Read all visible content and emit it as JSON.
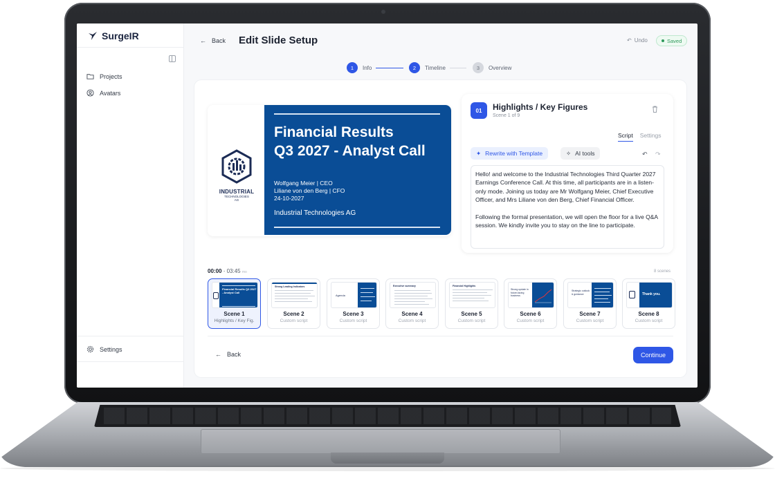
{
  "app": {
    "name": "SurgeIR"
  },
  "sidebar": {
    "items": [
      {
        "label": "Projects",
        "icon": "folder-icon"
      },
      {
        "label": "Avatars",
        "icon": "user-circle-icon"
      }
    ],
    "settings_label": "Settings"
  },
  "header": {
    "back_label": "Back",
    "title": "Edit Slide Setup",
    "undo_label": "Undo",
    "saved_label": "Saved"
  },
  "stepper": [
    {
      "number": "1",
      "label": "Info",
      "state": "done"
    },
    {
      "number": "2",
      "label": "Timeline",
      "state": "active"
    },
    {
      "number": "3",
      "label": "Overview",
      "state": "upcoming"
    }
  ],
  "slide": {
    "logo_line1": "INDUSTRIAL",
    "logo_line2": "TECHNOLOGIES",
    "logo_line3": "AG",
    "title_line1": "Financial Results",
    "title_line2": "Q3 2027 - Analyst Call",
    "meta_line1": "Wolfgang Meier | CEO",
    "meta_line2": "Liliane von den Berg | CFO",
    "meta_line3": "24-10-2027",
    "company": "Industrial Technologies AG"
  },
  "script_panel": {
    "badge": "01",
    "title": "Highlights / Key Figures",
    "subtitle": "Scene 1 of 9",
    "tab_script": "Script",
    "tab_settings": "Settings",
    "rewrite_label": "Rewrite with Template",
    "ai_tools_label": "AI tools",
    "paragraph1": "Hello! and welcome to the Industrial Technologies Third Quarter 2027 Earnings Conference Call. At this time, all participants are in a listen-only mode. Joining us today are Mr Wolfgang Meier, Chief Executive Officer, and Mrs Liliane von den Berg, Chief Financial Officer.",
    "paragraph2": "Following the formal presentation, we will open the floor for a live Q&A session. We kindly invite you to stay on the line to participate."
  },
  "timeline": {
    "current_time": "00:00",
    "total_time": "03:45",
    "total_suffix": "mo",
    "scene_count": "8 scenes",
    "scenes": [
      {
        "name": "Scene 1",
        "desc": "Highlights / Key Fig.",
        "thumb_text": "Financial Results Q3 2027 - Analyst Call",
        "active": true
      },
      {
        "name": "Scene 2",
        "desc": "Custom script",
        "thumb_text": "Strong Leading Indicators"
      },
      {
        "name": "Scene 3",
        "desc": "Custom script",
        "thumb_text": "Agenda"
      },
      {
        "name": "Scene 4",
        "desc": "Custom script",
        "thumb_text": "Executive summary"
      },
      {
        "name": "Scene 5",
        "desc": "Custom script",
        "thumb_text": "Financial Highlights"
      },
      {
        "name": "Scene 6",
        "desc": "Custom script",
        "thumb_text": "Strong update in future-facing business"
      },
      {
        "name": "Scene 7",
        "desc": "Custom script",
        "thumb_text": "Strategic outlook & guidance"
      },
      {
        "name": "Scene 8",
        "desc": "Custom script",
        "thumb_text": "Thank you."
      }
    ]
  },
  "footer": {
    "back_label": "Back",
    "continue_label": "Continue"
  },
  "colors": {
    "accent": "#2f57e6",
    "slide_blue": "#0a4d96",
    "saved_green": "#2e9a5b"
  }
}
